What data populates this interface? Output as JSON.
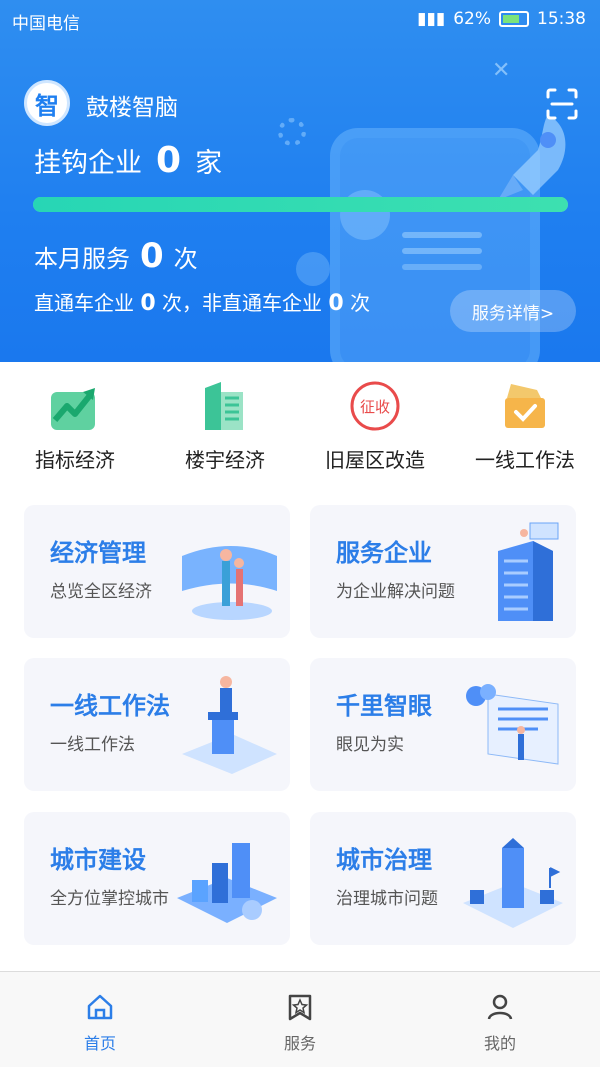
{
  "status_bar": {
    "carrier": "中国电信",
    "battery": "62%",
    "time": "15:38"
  },
  "header": {
    "logo_char": "智",
    "app_name": "鼓楼智脑",
    "linked_label": "挂钩企业",
    "linked_count": "0",
    "linked_unit": "家",
    "progress": 1.0,
    "monthly_label": "本月服务",
    "monthly_count": "0",
    "monthly_unit": "次",
    "sub_a_label": "直通车企业",
    "sub_a_count": "0",
    "sub_a_unit": "次，",
    "sub_b_label": "非直通车企业",
    "sub_b_count": "0",
    "sub_b_unit": "次",
    "detail_button": "服务详情>"
  },
  "quick": [
    {
      "label": "指标经济",
      "icon": "chart-up-icon"
    },
    {
      "label": "楼宇经济",
      "icon": "building-icon"
    },
    {
      "label": "旧屋区改造",
      "icon": "stamp-icon",
      "stamp_text": "征收"
    },
    {
      "label": "一线工作法",
      "icon": "gift-box-icon"
    }
  ],
  "cards": [
    {
      "title": "经济管理",
      "subtitle": "总览全区经济"
    },
    {
      "title": "服务企业",
      "subtitle": "为企业解决问题"
    },
    {
      "title": "一线工作法",
      "subtitle": "一线工作法"
    },
    {
      "title": "千里智眼",
      "subtitle": "眼见为实"
    },
    {
      "title": "城市建设",
      "subtitle": "全方位掌控城市"
    },
    {
      "title": "城市治理",
      "subtitle": "治理城市问题"
    }
  ],
  "tabs": [
    {
      "label": "首页",
      "active": true
    },
    {
      "label": "服务",
      "active": false
    },
    {
      "label": "我的",
      "active": false
    }
  ],
  "colors": {
    "primary": "#1f7ff0",
    "accent_text": "#2c7ee8",
    "progress": "#27d6b5"
  }
}
